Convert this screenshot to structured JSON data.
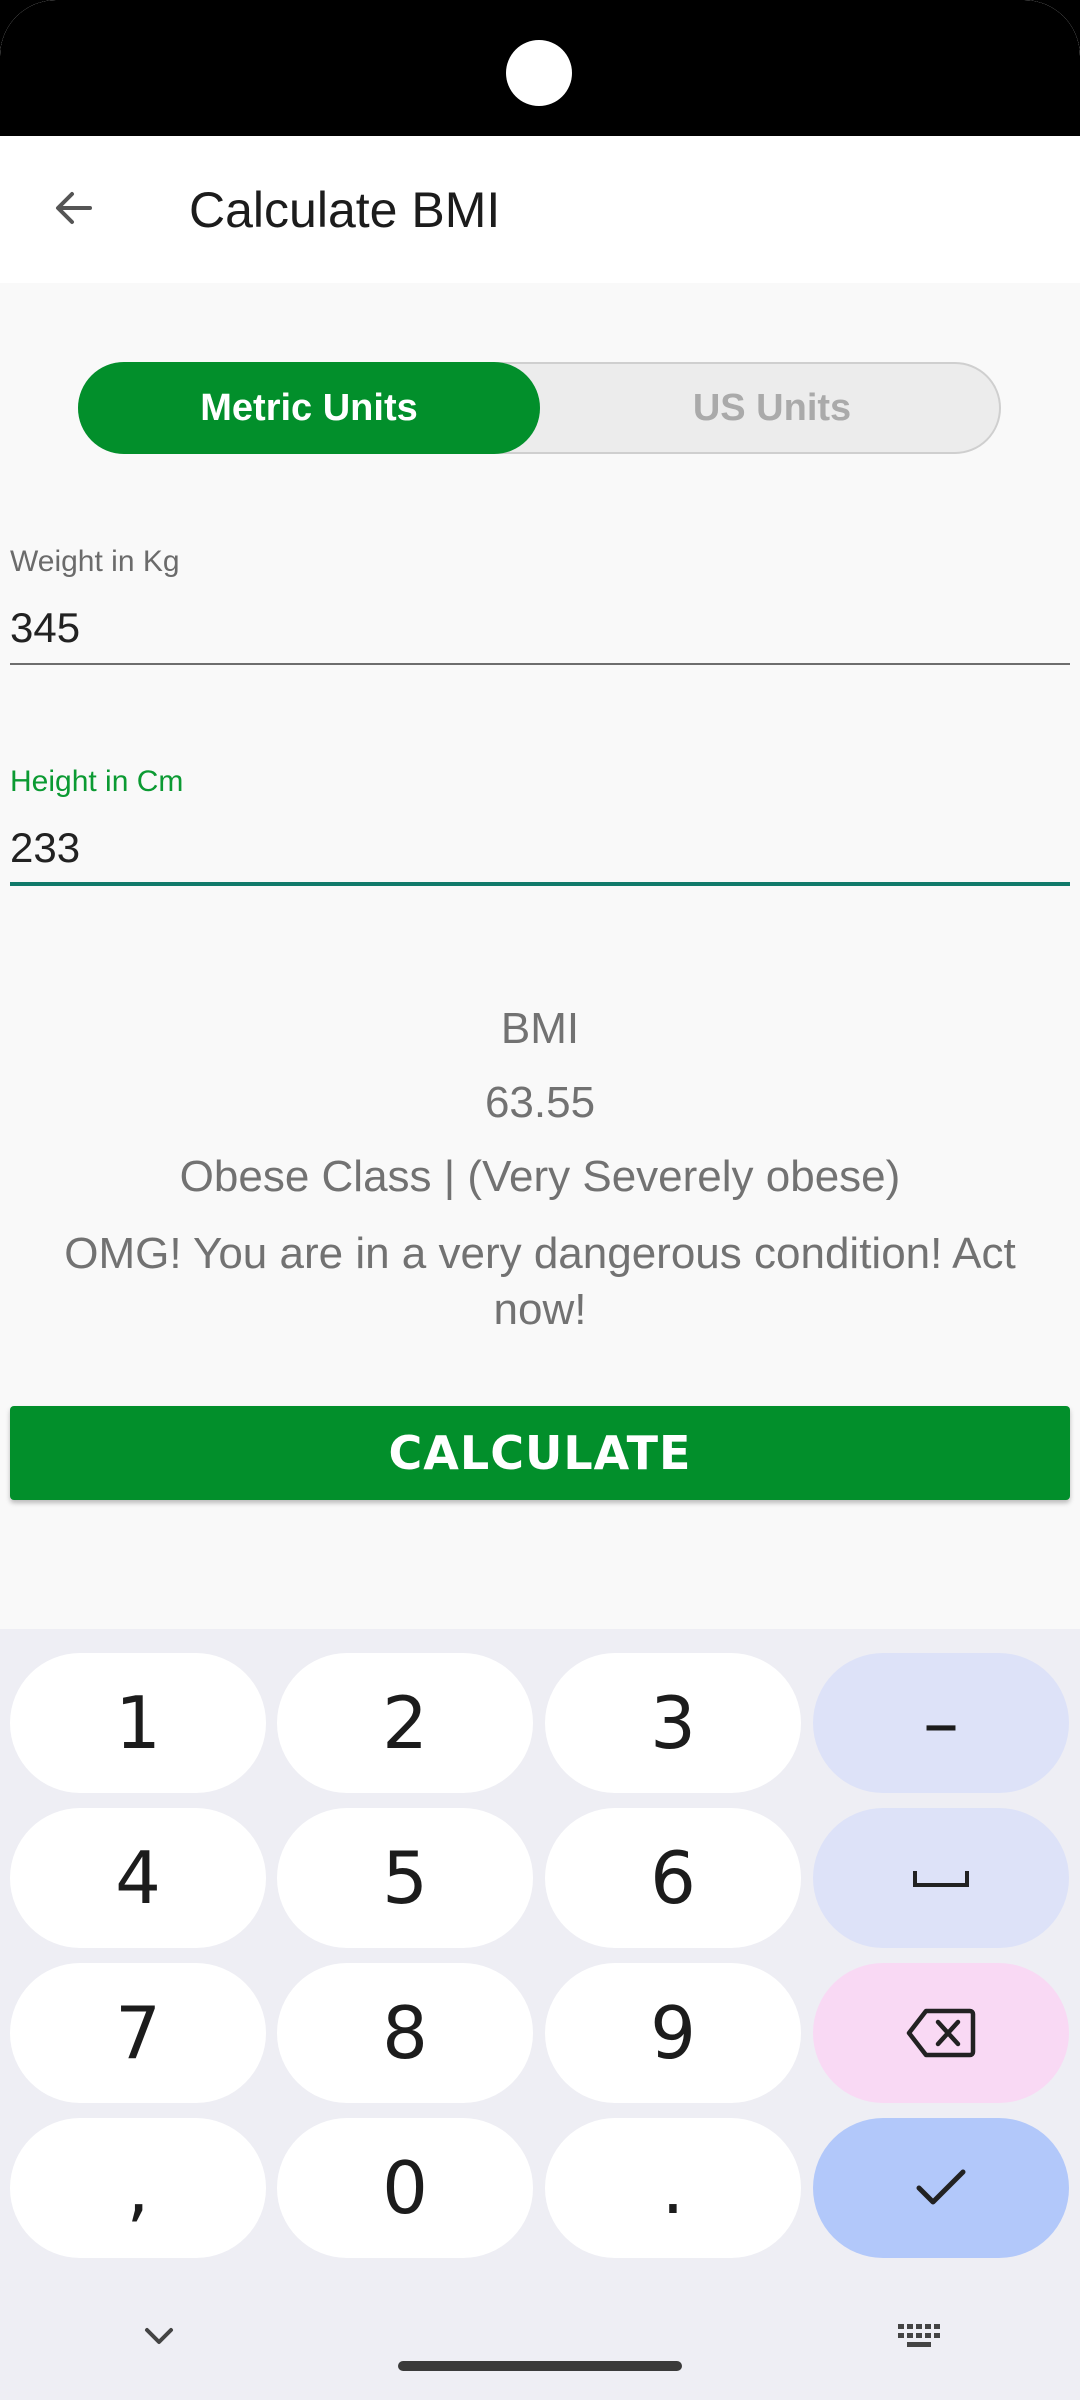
{
  "app_bar": {
    "title": "Calculate BMI",
    "back_icon": "arrow-left-icon"
  },
  "units_toggle": {
    "metric_label": "Metric Units",
    "us_label": "US Units",
    "selected": "Metric Units"
  },
  "fields": {
    "weight_label": "Weight in Kg",
    "weight_value": "345",
    "height_label": "Height in Cm",
    "height_value": "233"
  },
  "result": {
    "label": "BMI",
    "value": "63.55",
    "class": "Obese Class | (Very Severely obese)",
    "message": "OMG! You are in a very dangerous condition! Act now!"
  },
  "calculate_label": "CALCULATE",
  "keyboard": {
    "keys": [
      "1",
      "2",
      "3",
      "–",
      "4",
      "5",
      "6",
      "⎵",
      "7",
      "8",
      "9",
      "⌫",
      ",",
      "0",
      ".",
      "✓"
    ],
    "hide_icon": "chevron-down-icon",
    "switch_icon": "keyboard-icon"
  },
  "colors": {
    "accent": "#028f2b",
    "focus_label": "#0b9a32",
    "focus_line": "#117a6a"
  }
}
